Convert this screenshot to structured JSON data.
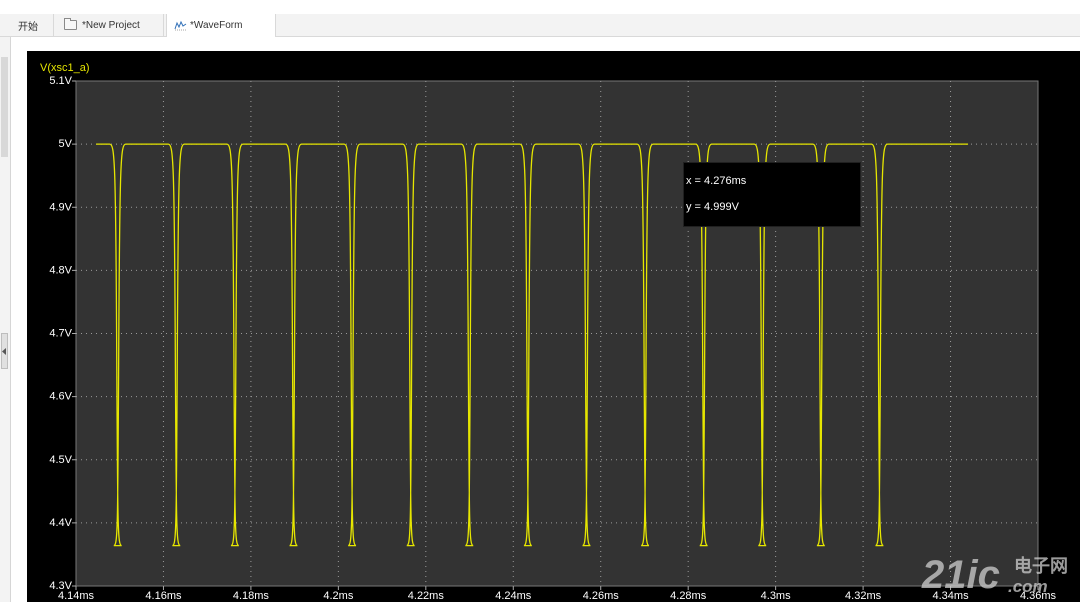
{
  "tabs": [
    {
      "label": "开始"
    },
    {
      "label": "*New Project"
    },
    {
      "label": "*WaveForm"
    }
  ],
  "readout": {
    "x": "x = 4.276ms",
    "y": "y = 4.999V"
  },
  "watermark": {
    "text": "21ic.com",
    "chinese": "电子网"
  },
  "colors": {
    "trace": "#e6e600",
    "background": "#000000",
    "plot_bg": "#333333",
    "grid": "#9a9a9a"
  },
  "chart_data": {
    "type": "line",
    "ylabel": "V(xsc1_a)",
    "xlabel": "",
    "xlim": [
      4.14,
      4.36
    ],
    "ylim": [
      4.3,
      5.1
    ],
    "x_ticks": [
      "4.14ms",
      "4.16ms",
      "4.18ms",
      "4.2ms",
      "4.22ms",
      "4.24ms",
      "4.26ms",
      "4.28ms",
      "4.3ms",
      "4.32ms",
      "4.34ms",
      "4.36ms"
    ],
    "y_ticks": [
      "5.1V",
      "5V",
      "4.9V",
      "4.8V",
      "4.7V",
      "4.6V",
      "4.5V",
      "4.4V",
      "4.3V"
    ],
    "series": [
      {
        "name": "V(xsc1_a)",
        "color": "#e6e600",
        "pulse_train": {
          "high": 5.0,
          "low": 4.364,
          "x_start": 4.1446,
          "x_end": 4.344,
          "low_pulse_starts": [
            4.1477,
            4.1611,
            4.1745,
            4.1879,
            4.2013,
            4.2147,
            4.2281,
            4.2415,
            4.2549,
            4.2683,
            4.2817,
            4.2951,
            4.3085,
            4.3219
          ],
          "low_pulse_width": 0.00345
        }
      }
    ]
  }
}
